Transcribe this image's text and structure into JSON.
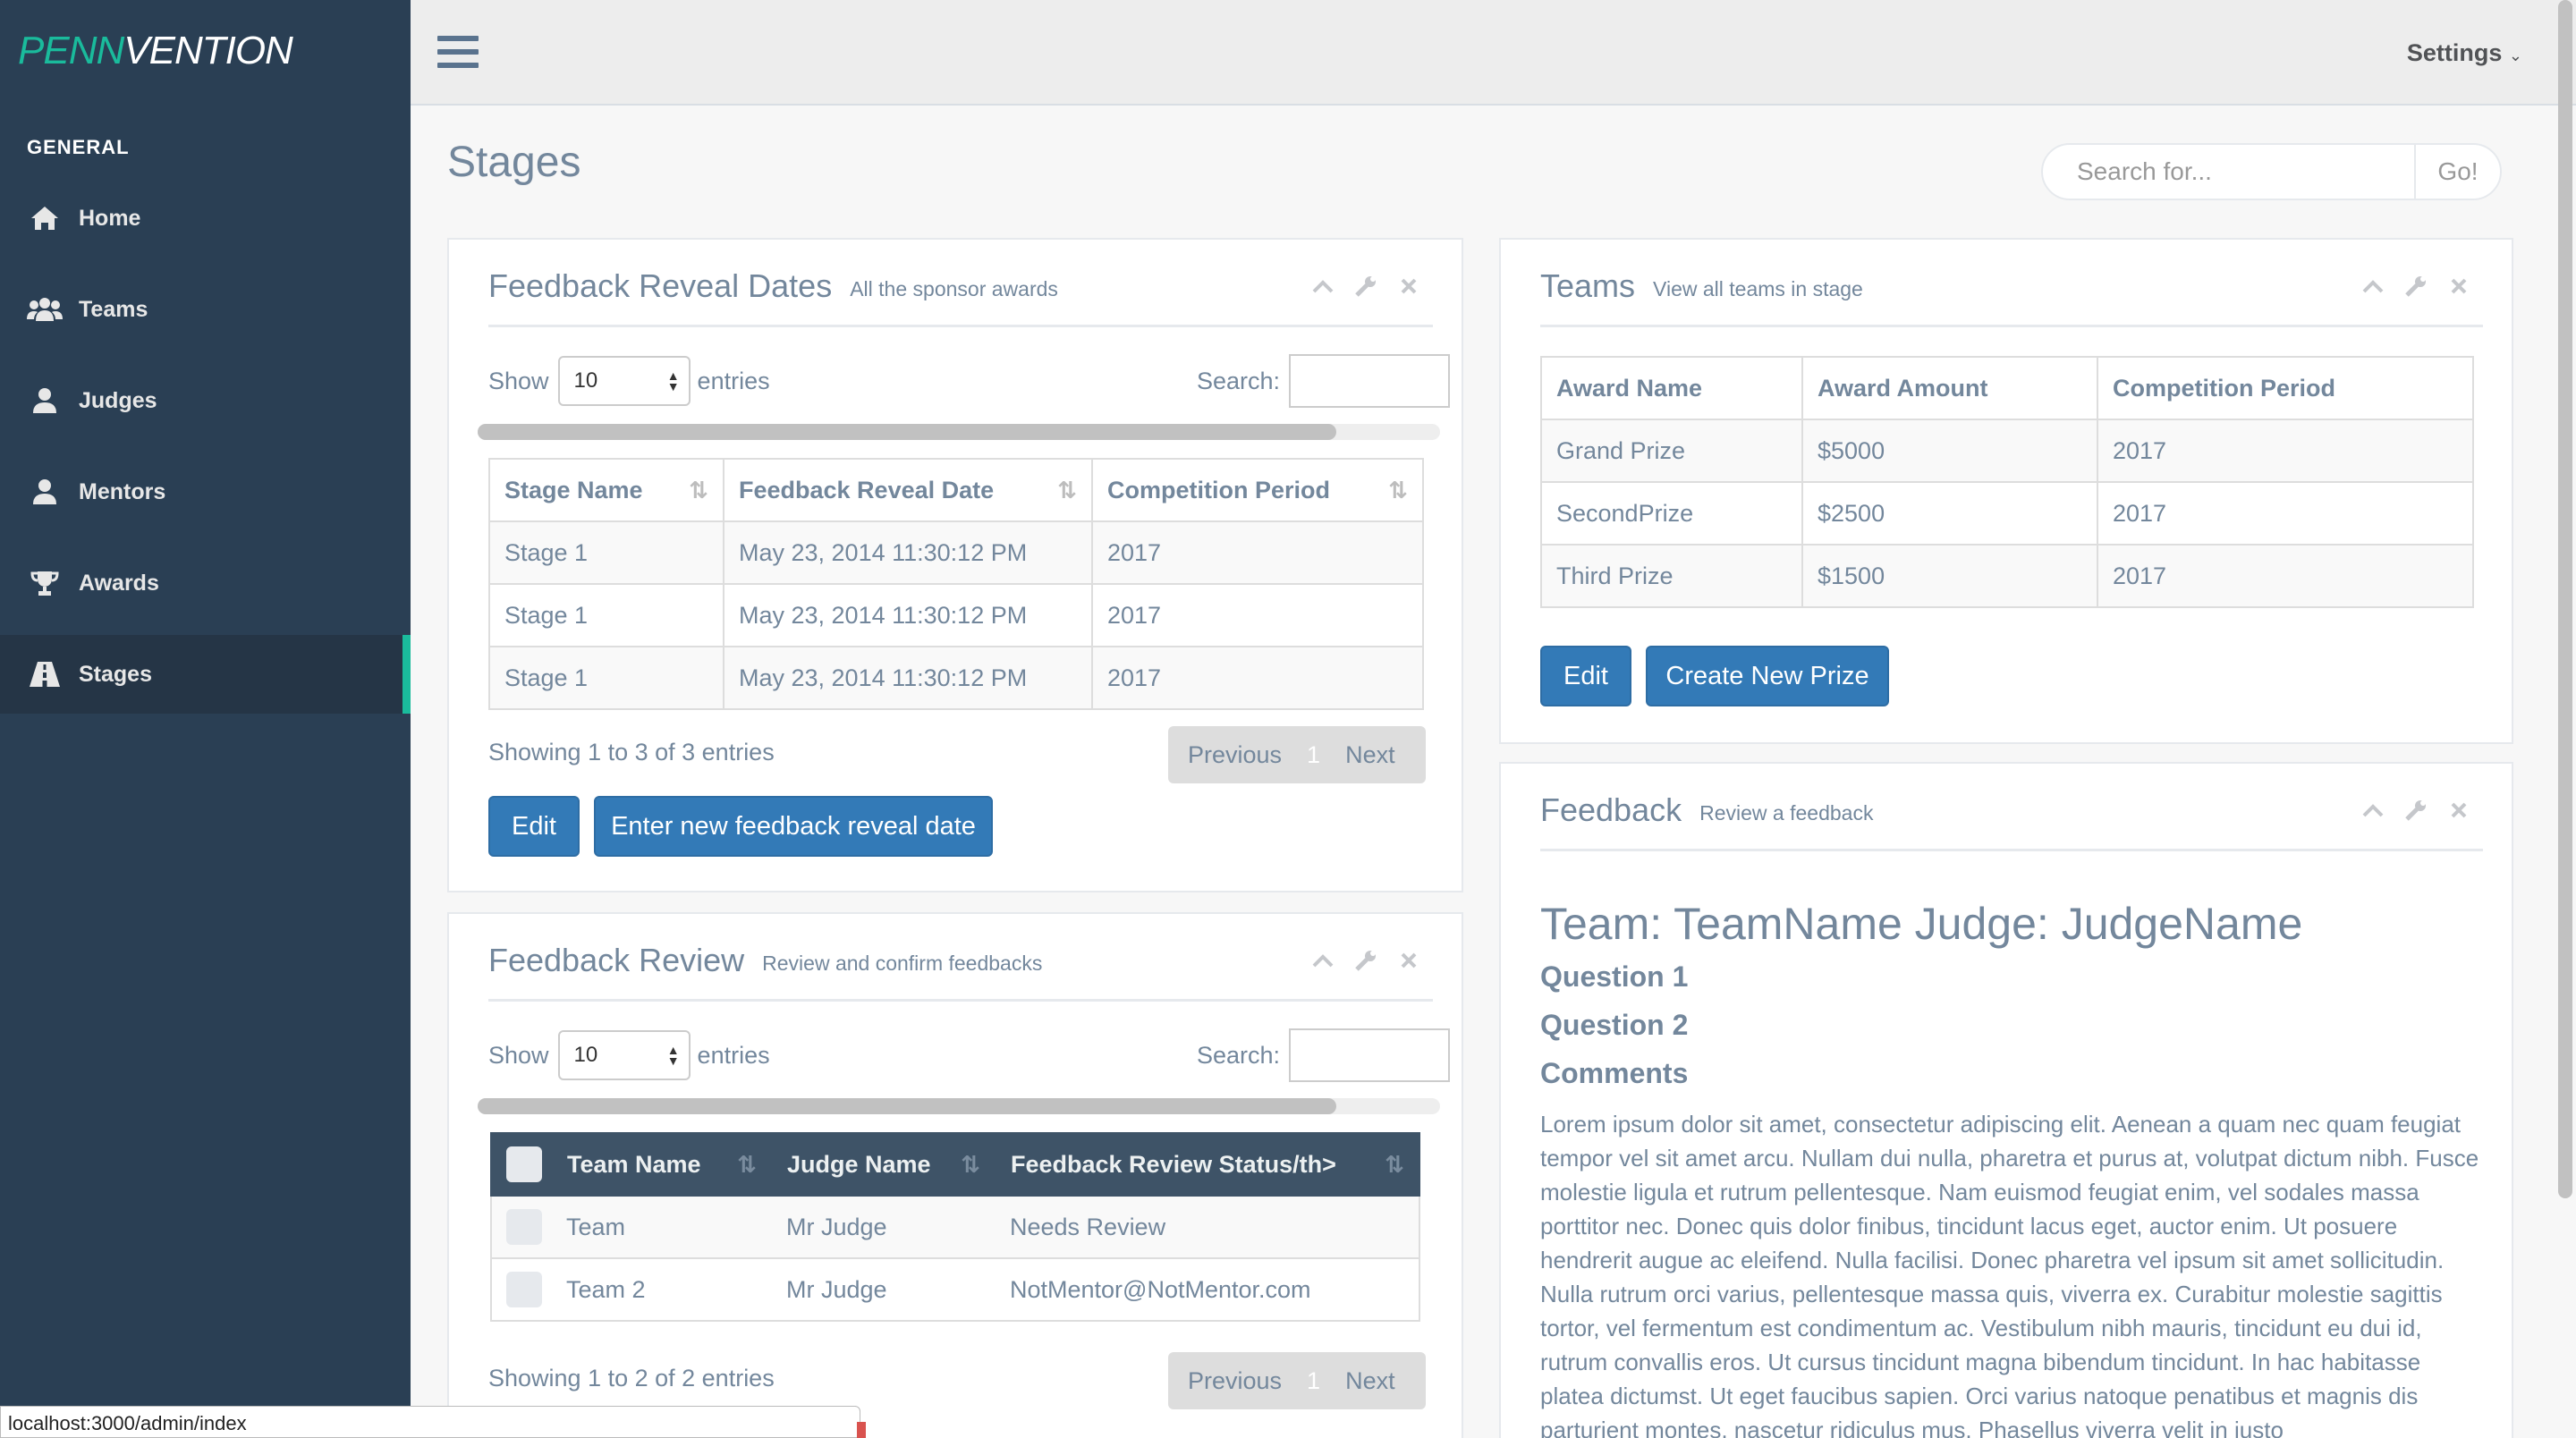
{
  "brand": {
    "part1": "PENN",
    "part2": "VENTION"
  },
  "sidebar": {
    "section_title": "GENERAL",
    "items": [
      {
        "label": "Home",
        "icon": "home-icon"
      },
      {
        "label": "Teams",
        "icon": "users-icon"
      },
      {
        "label": "Judges",
        "icon": "user-icon"
      },
      {
        "label": "Mentors",
        "icon": "user-icon"
      },
      {
        "label": "Awards",
        "icon": "trophy-icon"
      },
      {
        "label": "Stages",
        "icon": "road-icon",
        "active": true
      }
    ]
  },
  "topnav": {
    "settings_label": "Settings"
  },
  "page": {
    "title": "Stages",
    "search_placeholder": "Search for...",
    "search_button": "Go!"
  },
  "feedback_reveal": {
    "title": "Feedback Reveal Dates",
    "subtitle": "All the sponsor awards",
    "show_label": "Show",
    "entries_value": "10",
    "entries_label": "entries",
    "search_label": "Search:",
    "columns": [
      "Stage Name",
      "Feedback Reveal Date",
      "Competition Period"
    ],
    "rows": [
      [
        "Stage 1",
        "May 23, 2014 11:30:12 PM",
        "2017"
      ],
      [
        "Stage 1",
        "May 23, 2014 11:30:12 PM",
        "2017"
      ],
      [
        "Stage 1",
        "May 23, 2014 11:30:12 PM",
        "2017"
      ]
    ],
    "info": "Showing 1 to 3 of 3 entries",
    "prev": "Previous",
    "page": "1",
    "next": "Next",
    "edit_button": "Edit",
    "new_button": "Enter new feedback reveal date"
  },
  "teams": {
    "title": "Teams",
    "subtitle": "View all teams in stage",
    "columns": [
      "Award Name",
      "Award Amount",
      "Competition Period"
    ],
    "rows": [
      [
        "Grand Prize",
        "$5000",
        "2017"
      ],
      [
        "SecondPrize",
        "$2500",
        "2017"
      ],
      [
        "Third Prize",
        "$1500",
        "2017"
      ]
    ],
    "edit_button": "Edit",
    "create_button": "Create New Prize"
  },
  "feedback_review": {
    "title": "Feedback Review",
    "subtitle": "Review and confirm feedbacks",
    "show_label": "Show",
    "entries_value": "10",
    "entries_label": "entries",
    "search_label": "Search:",
    "columns": [
      "Team Name",
      "Judge Name",
      "Feedback Review Status/th>"
    ],
    "rows": [
      [
        "Team",
        "Mr Judge",
        "Needs Review"
      ],
      [
        "Team 2",
        "Mr Judge",
        "NotMentor@NotMentor.com"
      ]
    ],
    "info": "Showing 1 to 2 of 2 entries",
    "prev": "Previous",
    "page": "1",
    "next": "Next"
  },
  "feedback": {
    "title": "Feedback",
    "subtitle": "Review a feedback",
    "heading": "Team: TeamName Judge: JudgeName",
    "question1": "Question 1",
    "question2": "Question 2",
    "comments": "Comments",
    "body": "Lorem ipsum dolor sit amet, consectetur adipiscing elit. Aenean a quam nec quam feugiat tempor vel sit amet arcu. Nullam dui nulla, pharetra et purus at, volutpat dictum nibh. Fusce molestie ligula et rutrum pellentesque. Nam euismod feugiat enim, vel sodales massa porttitor nec. Donec quis dolor finibus, tincidunt lacus eget, auctor enim. Ut posuere hendrerit augue ac eleifend. Nulla facilisi. Donec pharetra vel ipsum sit amet sollicitudin. Nulla rutrum orci varius, pellentesque massa quis, viverra ex. Curabitur molestie sagittis tortor, vel fermentum est condimentum ac. Vestibulum nibh mauris, tincidunt eu dui id, rutrum convallis eros. Ut cursus tincidunt magna bibendum tincidunt. In hac habitasse platea dictumst. Ut eget faucibus sapien. Orci varius natoque penatibus et magnis dis parturient montes, nascetur ridiculus mus. Phasellus viverra velit in justo"
  },
  "status_bar": {
    "url": "localhost:3000/admin/index"
  },
  "colors": {
    "sidebar": "#2A3F54",
    "accent": "#1ABB9C",
    "primary": "#337AB7"
  }
}
